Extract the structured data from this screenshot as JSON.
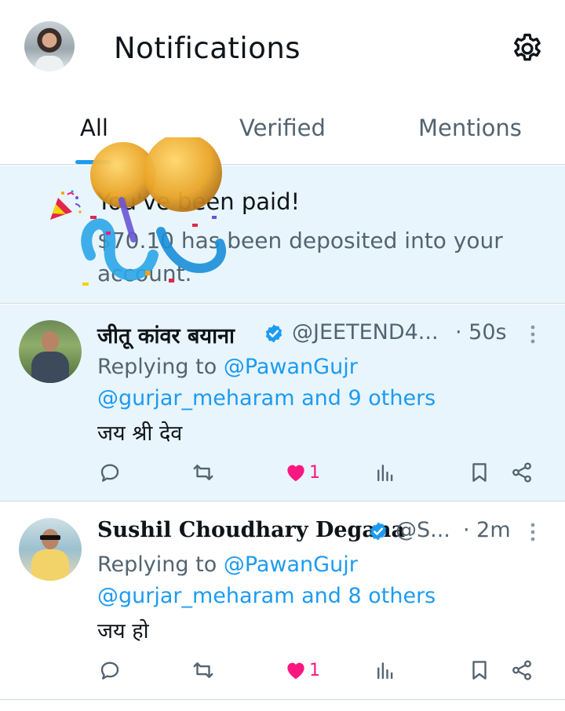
{
  "header": {
    "title": "Notifications",
    "avatar_icon": "profile-avatar",
    "settings_icon": "gear-icon"
  },
  "tabs": [
    {
      "label": "All",
      "active": true
    },
    {
      "label": "Verified",
      "active": false
    },
    {
      "label": "Mentions",
      "active": false
    }
  ],
  "payment": {
    "icon": "party-popper-icon",
    "title": "You've been paid!",
    "body": "$70.10 has been deposited into your account."
  },
  "tweets": [
    {
      "name": "जीतू कांवर बयाना",
      "handle": "@JEETEND4...",
      "time": "· 50s",
      "reply_prefix": "Replying to ",
      "reply_mention": "@PawanGujr",
      "reply_line2": "@gurjar_meharam and 9 others",
      "text": "जय श्री देव",
      "likes": "1"
    },
    {
      "name": "Sushil Choudhary Degana",
      "handle": "@S...",
      "time": "· 2m",
      "reply_prefix": "Replying to ",
      "reply_mention": "@PawanGujr",
      "reply_line2": "@gurjar_meharam and 8 others",
      "text": "जय हो",
      "likes": "1"
    }
  ],
  "colors": {
    "accent": "#1d9bf0",
    "like": "#f91880",
    "highlight_bg": "#e8f5fd",
    "secondary_text": "#536471"
  }
}
